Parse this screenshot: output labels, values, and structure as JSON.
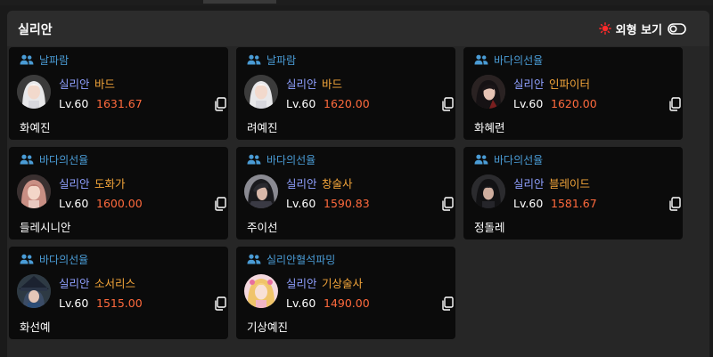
{
  "server_title": "실리안",
  "appearance_toggle": {
    "label": "외형 보기",
    "enabled": false
  },
  "colors": {
    "guild": "#4a9cd6",
    "server": "#8fa0ff",
    "class": "#f3a53a",
    "item_level": "#ff6a3d",
    "card_bg": "#0b0b0b",
    "panel_bg": "#262626"
  },
  "characters": [
    {
      "guild": "날파람",
      "server": "실리안",
      "class": "바드",
      "level": "Lv.60",
      "item_level": "1631.67",
      "name": "화예진",
      "avatar": "white-hair-portrait"
    },
    {
      "guild": "날파람",
      "server": "실리안",
      "class": "바드",
      "level": "Lv.60",
      "item_level": "1620.00",
      "name": "려예진",
      "avatar": "white-hair-portrait"
    },
    {
      "guild": "바다의선율",
      "server": "실리안",
      "class": "인파이터",
      "level": "Lv.60",
      "item_level": "1620.00",
      "name": "화혜련",
      "avatar": "dark-hair-portrait"
    },
    {
      "guild": "바다의선율",
      "server": "실리안",
      "class": "도화가",
      "level": "Lv.60",
      "item_level": "1600.00",
      "name": "들레시니안",
      "avatar": "pink-hair-portrait"
    },
    {
      "guild": "바다의선율",
      "server": "실리안",
      "class": "창술사",
      "level": "Lv.60",
      "item_level": "1590.83",
      "name": "주이선",
      "avatar": "dark-helmet-portrait"
    },
    {
      "guild": "바다의선율",
      "server": "실리안",
      "class": "블레이드",
      "level": "Lv.60",
      "item_level": "1581.67",
      "name": "정돌레",
      "avatar": "dark-hood-portrait"
    },
    {
      "guild": "바다의선율",
      "server": "실리안",
      "class": "소서리스",
      "level": "Lv.60",
      "item_level": "1515.00",
      "name": "화선예",
      "avatar": "witch-hat-portrait"
    },
    {
      "guild": "실리안혈석파밍",
      "server": "실리안",
      "class": "기상술사",
      "level": "Lv.60",
      "item_level": "1490.00",
      "name": "기상예진",
      "avatar": "blonde-hair-portrait"
    }
  ]
}
